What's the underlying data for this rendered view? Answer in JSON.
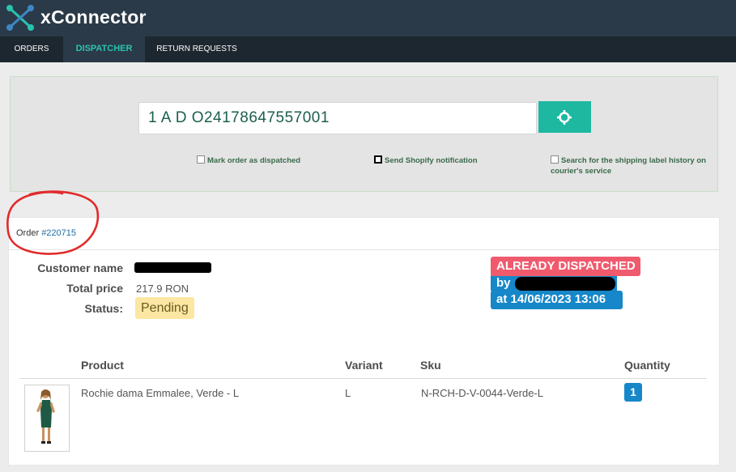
{
  "app": {
    "brand": "xConnector",
    "accent": "#1eb8a1"
  },
  "nav": {
    "items": [
      {
        "label": "ORDERS",
        "active": false
      },
      {
        "label": "DISPATCHER",
        "active": true
      },
      {
        "label": "RETURN REQUESTS",
        "active": false
      }
    ]
  },
  "search": {
    "value": "1 A D O24178647557001",
    "button_icon": "crosshair-icon",
    "options": [
      {
        "label": "Mark order as dispatched",
        "checked": false
      },
      {
        "label": "Send Shopify notification",
        "checked": false
      },
      {
        "label": "Search for the shipping label history on courier's service",
        "checked": false
      }
    ]
  },
  "order": {
    "label": "Order",
    "number": "#220715",
    "fields": [
      {
        "label": "Customer name"
      },
      {
        "label": "Total price",
        "value": "217.9 RON"
      },
      {
        "label": "Status:",
        "value": "Pending"
      }
    ],
    "dispatch": {
      "title": "ALREADY DISPATCHED",
      "by_label": "by",
      "at_text": "at 14/06/2023 13:06"
    }
  },
  "table": {
    "headers": [
      "Product",
      "Variant",
      "Sku",
      "Quantity"
    ],
    "rows": [
      {
        "product": "Rochie dama Emmalee, Verde - L",
        "variant": "L",
        "sku": "N-RCH-D-V-0044-Verde-L",
        "quantity": "1"
      }
    ]
  }
}
